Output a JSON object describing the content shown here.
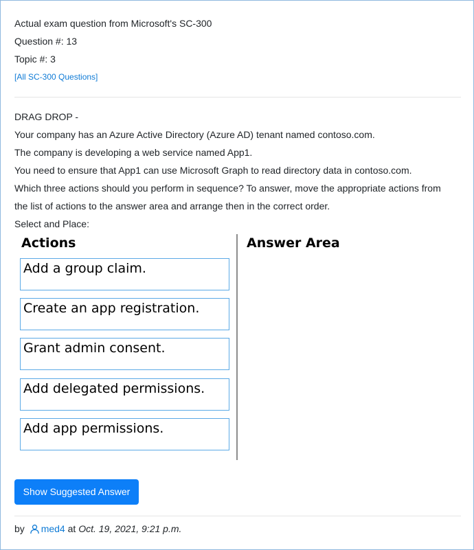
{
  "header": {
    "title": "Actual exam question from Microsoft's SC-300",
    "question_no": "Question #: 13",
    "topic_no": "Topic #: 3",
    "all_link": "[All SC-300 Questions]"
  },
  "question": {
    "lines": [
      "DRAG DROP -",
      "Your company has an Azure Active Directory (Azure AD) tenant named contoso.com.",
      "The company is developing a web service named App1.",
      "You need to ensure that App1 can use Microsoft Graph to read directory data in contoso.com.",
      "Which three actions should you perform in sequence? To answer, move the appropriate actions from",
      "the list of actions to the answer area and arrange then in the correct order.",
      "Select and Place:"
    ]
  },
  "drag_drop": {
    "actions_title": "Actions",
    "answer_title": "Answer Area",
    "actions": [
      "Add a group claim.",
      "Create an app registration.",
      "Grant admin consent.",
      "Add delegated permissions.",
      "Add app permissions."
    ]
  },
  "button": {
    "label": "Show Suggested Answer"
  },
  "footer": {
    "by": "by",
    "user_icon": "user-icon",
    "user": "med4",
    "at": "at",
    "date": "Oct. 19, 2021, 9:21 p.m."
  },
  "colors": {
    "link": "#0f7bd6",
    "button": "#0d7ff8",
    "box_border": "#5aa9e6",
    "card_border": "#8fb8de"
  }
}
